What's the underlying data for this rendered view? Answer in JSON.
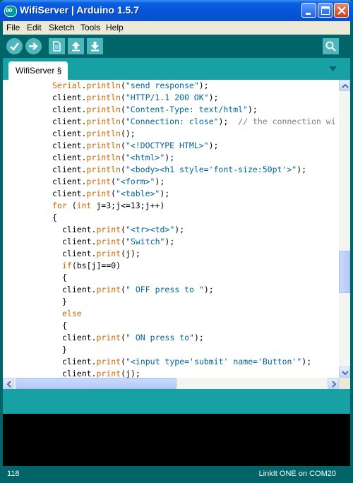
{
  "window": {
    "title": "WifiServer | Arduino 1.5.7",
    "logo_text": "oo"
  },
  "menu": {
    "items": [
      "File",
      "Edit",
      "Sketch",
      "Tools",
      "Help"
    ]
  },
  "toolbar": {
    "buttons": [
      "verify-icon",
      "upload-icon",
      "new-icon",
      "open-icon",
      "save-icon",
      "serial-monitor-icon"
    ]
  },
  "tabs": [
    {
      "label": "WifiServer §"
    }
  ],
  "editor": {
    "lines": [
      {
        "indent": 8,
        "tokens": [
          [
            "kw",
            "Serial"
          ],
          [
            "",
            "."
          ],
          [
            "kw",
            "println"
          ],
          [
            "",
            "("
          ],
          [
            "str",
            "\"send response\""
          ],
          [
            "",
            ");"
          ]
        ]
      },
      {
        "indent": 8,
        "tokens": [
          [
            "",
            "client."
          ],
          [
            "kw",
            "println"
          ],
          [
            "",
            "("
          ],
          [
            "str",
            "\"HTTP/1.1 200 OK\""
          ],
          [
            "",
            ");"
          ]
        ]
      },
      {
        "indent": 8,
        "tokens": [
          [
            "",
            "client."
          ],
          [
            "kw",
            "println"
          ],
          [
            "",
            "("
          ],
          [
            "str",
            "\"Content-Type: text/html\""
          ],
          [
            "",
            ");"
          ]
        ]
      },
      {
        "indent": 8,
        "tokens": [
          [
            "",
            "client."
          ],
          [
            "kw",
            "println"
          ],
          [
            "",
            "("
          ],
          [
            "str",
            "\"Connection: close\""
          ],
          [
            "",
            ");  "
          ],
          [
            "cmt",
            "// the connection wi"
          ]
        ]
      },
      {
        "indent": 8,
        "tokens": [
          [
            "",
            "client."
          ],
          [
            "kw",
            "println"
          ],
          [
            "",
            "();"
          ]
        ]
      },
      {
        "indent": 8,
        "tokens": [
          [
            "",
            "client."
          ],
          [
            "kw",
            "println"
          ],
          [
            "",
            "("
          ],
          [
            "str",
            "\"<!DOCTYPE HTML>\""
          ],
          [
            "",
            ");"
          ]
        ]
      },
      {
        "indent": 8,
        "tokens": [
          [
            "",
            "client."
          ],
          [
            "kw",
            "println"
          ],
          [
            "",
            "("
          ],
          [
            "str",
            "\"<html>\""
          ],
          [
            "",
            ");"
          ]
        ]
      },
      {
        "indent": 8,
        "tokens": [
          [
            "",
            "client."
          ],
          [
            "kw",
            "println"
          ],
          [
            "",
            "("
          ],
          [
            "str",
            "\"<body><h1 style='font-size:50pt'>\""
          ],
          [
            "",
            ");"
          ]
        ]
      },
      {
        "indent": 8,
        "tokens": [
          [
            "",
            "client."
          ],
          [
            "kw",
            "print"
          ],
          [
            "",
            "("
          ],
          [
            "str",
            "\"<form>\""
          ],
          [
            "",
            ");"
          ]
        ]
      },
      {
        "indent": 8,
        "tokens": [
          [
            "",
            "client."
          ],
          [
            "kw",
            "print"
          ],
          [
            "",
            "("
          ],
          [
            "str",
            "\"<table>\""
          ],
          [
            "",
            ");"
          ]
        ]
      },
      {
        "indent": 8,
        "tokens": [
          [
            "kw",
            "for"
          ],
          [
            "",
            " ("
          ],
          [
            "kw",
            "int"
          ],
          [
            "",
            " j=3;j<=13;j++)"
          ]
        ]
      },
      {
        "indent": 8,
        "tokens": [
          [
            "",
            "{"
          ]
        ]
      },
      {
        "indent": 10,
        "tokens": [
          [
            "",
            "client."
          ],
          [
            "kw",
            "print"
          ],
          [
            "",
            "("
          ],
          [
            "str",
            "\"<tr><td>\""
          ],
          [
            "",
            ");"
          ]
        ]
      },
      {
        "indent": 10,
        "tokens": [
          [
            "",
            "client."
          ],
          [
            "kw",
            "print"
          ],
          [
            "",
            "("
          ],
          [
            "str",
            "\"Switch\""
          ],
          [
            "",
            ");"
          ]
        ]
      },
      {
        "indent": 10,
        "tokens": [
          [
            "",
            "client."
          ],
          [
            "kw",
            "print"
          ],
          [
            "",
            "(j);"
          ]
        ]
      },
      {
        "indent": 10,
        "tokens": [
          [
            "kw",
            "if"
          ],
          [
            "",
            "(bs[j]==0)"
          ]
        ]
      },
      {
        "indent": 10,
        "tokens": [
          [
            "",
            "{"
          ]
        ]
      },
      {
        "indent": 10,
        "tokens": [
          [
            "",
            "client."
          ],
          [
            "kw",
            "print"
          ],
          [
            "",
            "("
          ],
          [
            "str",
            "\" OFF press to \""
          ],
          [
            "",
            ");"
          ]
        ]
      },
      {
        "indent": 10,
        "tokens": [
          [
            "",
            "}"
          ]
        ]
      },
      {
        "indent": 10,
        "tokens": [
          [
            "kw",
            "else"
          ]
        ]
      },
      {
        "indent": 10,
        "tokens": [
          [
            "",
            "{"
          ]
        ]
      },
      {
        "indent": 10,
        "tokens": [
          [
            "",
            "client."
          ],
          [
            "kw",
            "print"
          ],
          [
            "",
            "("
          ],
          [
            "str",
            "\" ON press to\""
          ],
          [
            "",
            ");"
          ]
        ]
      },
      {
        "indent": 10,
        "tokens": [
          [
            "",
            "}"
          ]
        ]
      },
      {
        "indent": 10,
        "tokens": [
          [
            "",
            "client."
          ],
          [
            "kw",
            "print"
          ],
          [
            "",
            "("
          ],
          [
            "str",
            "\"<input type='submit' name='Button'\""
          ],
          [
            "",
            ");"
          ]
        ]
      },
      {
        "indent": 10,
        "tokens": [
          [
            "",
            "client."
          ],
          [
            "kw",
            "print"
          ],
          [
            "",
            "(j);"
          ]
        ]
      }
    ]
  },
  "status": {
    "line": "118",
    "board": "LinkIt ONE on COM20"
  },
  "colors": {
    "toolbar_bg": "#006468",
    "tab_bg": "#17a1a5",
    "button_fill": "#4db7bb",
    "keyword": "#cc6600",
    "string": "#006699",
    "comment": "#7e7e7e"
  }
}
